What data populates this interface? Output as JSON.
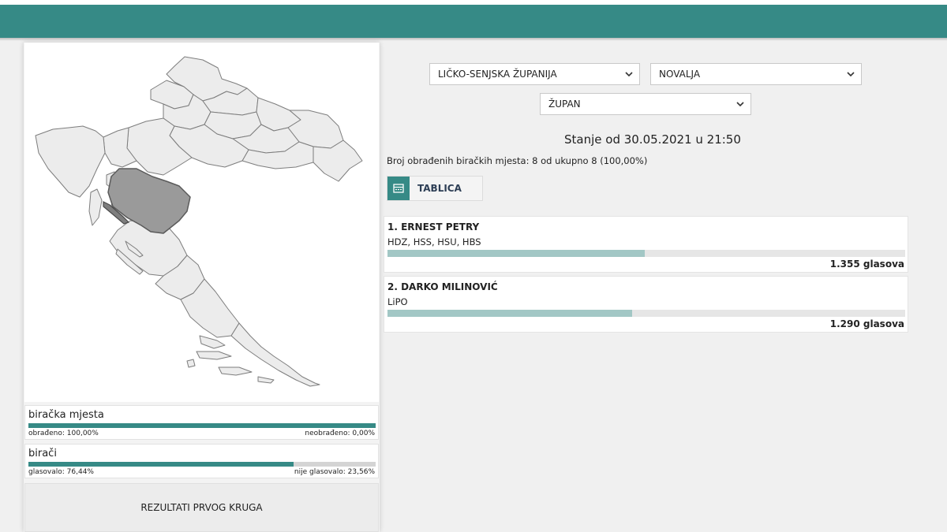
{
  "colors": {
    "accent": "#368a86",
    "highlight_region": "#9a9a9a",
    "bar_fill": "#a2c7c5"
  },
  "filters": {
    "county": "LIČKO-SENJSKA ŽUPANIJA",
    "municipality": "NOVALJA",
    "election_type": "ŽUPAN"
  },
  "status": {
    "stanje": "Stanje od 30.05.2021 u 21:50",
    "broj": "Broj obrađenih biračkih mjesta: 8 od ukupno 8 (100,00%)"
  },
  "view_toggle": {
    "label": "TABLICA",
    "icon": "table-icon"
  },
  "candidates": [
    {
      "name": "1. ERNEST PETRY",
      "party": "HDZ, HSS, HSU, HBS",
      "votes": "1.355 glasova",
      "share": 0.5123
    },
    {
      "name": "2. DARKO MILINOVIĆ",
      "party": "LiPO",
      "votes": "1.290 glasova",
      "share": 0.4877
    }
  ],
  "stats": {
    "polling": {
      "title": "biračka mjesta",
      "left": "obrađeno: 100,00%",
      "right": "neobrađeno: 0,00%",
      "fill": 1.0
    },
    "voters": {
      "title": "birači",
      "left": "glasovalo: 76,44%",
      "right": "nije glasovalo: 23,56%",
      "fill": 0.7644
    }
  },
  "first_round_button": "REZULTATI PRVOG KRUGA"
}
